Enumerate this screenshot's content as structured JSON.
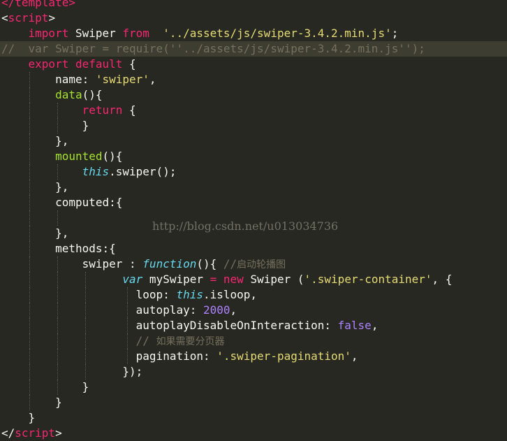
{
  "editor": {
    "lines": [
      {
        "highlight": false,
        "guides": [],
        "tokens": [
          [
            "t-tag",
            "</template>"
          ]
        ]
      },
      {
        "highlight": false,
        "guides": [],
        "tokens": [
          [
            "t-punc",
            "<"
          ],
          [
            "t-tag",
            "script"
          ],
          [
            "t-punc",
            ">"
          ]
        ]
      },
      {
        "highlight": false,
        "guides": [],
        "tokens": [
          [
            "t-plain",
            "    "
          ],
          [
            "t-kw",
            "import"
          ],
          [
            "t-plain",
            " Swiper "
          ],
          [
            "t-kw",
            "from"
          ],
          [
            "t-plain",
            "  "
          ],
          [
            "t-str",
            "'../assets/js/swiper-3.4.2.min.js'"
          ],
          [
            "t-plain",
            ";"
          ]
        ]
      },
      {
        "highlight": true,
        "guides": [],
        "tokens": [
          [
            "t-comment",
            "//  var Swiper = require(''../assets/js/swiper-3.4.2.min.js'');"
          ]
        ]
      },
      {
        "highlight": false,
        "guides": [],
        "tokens": [
          [
            "t-plain",
            "    "
          ],
          [
            "t-kw",
            "export"
          ],
          [
            "t-plain",
            " "
          ],
          [
            "t-kw",
            "default"
          ],
          [
            "t-plain",
            " {"
          ]
        ]
      },
      {
        "highlight": false,
        "guides": [
          42
        ],
        "tokens": [
          [
            "t-plain",
            "        name: "
          ],
          [
            "t-str",
            "'swiper'"
          ],
          [
            "t-plain",
            ","
          ]
        ]
      },
      {
        "highlight": false,
        "guides": [
          42
        ],
        "tokens": [
          [
            "t-plain",
            "        "
          ],
          [
            "t-fn",
            "data"
          ],
          [
            "t-plain",
            "(){"
          ]
        ]
      },
      {
        "highlight": false,
        "guides": [
          42,
          82
        ],
        "tokens": [
          [
            "t-plain",
            "            "
          ],
          [
            "t-kw",
            "return"
          ],
          [
            "t-plain",
            " {"
          ]
        ]
      },
      {
        "highlight": false,
        "guides": [
          42,
          82
        ],
        "tokens": [
          [
            "t-plain",
            "            }"
          ]
        ]
      },
      {
        "highlight": false,
        "guides": [
          42
        ],
        "tokens": [
          [
            "t-plain",
            "        },"
          ]
        ]
      },
      {
        "highlight": false,
        "guides": [
          42
        ],
        "tokens": [
          [
            "t-plain",
            "        "
          ],
          [
            "t-fn",
            "mounted"
          ],
          [
            "t-plain",
            "(){"
          ]
        ]
      },
      {
        "highlight": false,
        "guides": [
          42,
          82
        ],
        "tokens": [
          [
            "t-plain",
            "            "
          ],
          [
            "t-this",
            "this"
          ],
          [
            "t-plain",
            ".swiper();"
          ]
        ]
      },
      {
        "highlight": false,
        "guides": [
          42
        ],
        "tokens": [
          [
            "t-plain",
            "        },"
          ]
        ]
      },
      {
        "highlight": false,
        "guides": [
          42
        ],
        "tokens": [
          [
            "t-plain",
            "        computed:{"
          ]
        ]
      },
      {
        "highlight": false,
        "guides": [
          42,
          82
        ],
        "tokens": [
          [
            "t-plain",
            ""
          ]
        ]
      },
      {
        "highlight": false,
        "guides": [
          42
        ],
        "tokens": [
          [
            "t-plain",
            "        },"
          ]
        ]
      },
      {
        "highlight": false,
        "guides": [
          42
        ],
        "tokens": [
          [
            "t-plain",
            "        methods:{"
          ]
        ]
      },
      {
        "highlight": false,
        "guides": [
          42,
          82
        ],
        "tokens": [
          [
            "t-plain",
            "            swiper : "
          ],
          [
            "t-storage",
            "function"
          ],
          [
            "t-plain",
            "(){ "
          ],
          [
            "t-comment",
            "//"
          ],
          [
            "t-comment-cjk",
            "启动轮播图"
          ]
        ]
      },
      {
        "highlight": false,
        "guides": [
          42,
          82,
          122
        ],
        "tokens": [
          [
            "t-plain",
            "                  "
          ],
          [
            "t-storage",
            "var"
          ],
          [
            "t-plain",
            " mySwiper "
          ],
          [
            "t-kw",
            "="
          ],
          [
            "t-plain",
            " "
          ],
          [
            "t-kw",
            "new"
          ],
          [
            "t-plain",
            " Swiper ("
          ],
          [
            "t-str",
            "'.swiper-container'"
          ],
          [
            "t-plain",
            ", {"
          ]
        ]
      },
      {
        "highlight": false,
        "guides": [
          42,
          82,
          122,
          182
        ],
        "tokens": [
          [
            "t-plain",
            "                    loop: "
          ],
          [
            "t-this",
            "this"
          ],
          [
            "t-plain",
            ".isloop,"
          ]
        ]
      },
      {
        "highlight": false,
        "guides": [
          42,
          82,
          122,
          182
        ],
        "tokens": [
          [
            "t-plain",
            "                    autoplay: "
          ],
          [
            "t-num",
            "2000"
          ],
          [
            "t-plain",
            ","
          ]
        ]
      },
      {
        "highlight": false,
        "guides": [
          42,
          82,
          122,
          182
        ],
        "tokens": [
          [
            "t-plain",
            "                    autoplayDisableOnInteraction: "
          ],
          [
            "t-const",
            "false"
          ],
          [
            "t-plain",
            ","
          ]
        ]
      },
      {
        "highlight": false,
        "guides": [
          42,
          82,
          122,
          182
        ],
        "tokens": [
          [
            "t-plain",
            "                    "
          ],
          [
            "t-comment",
            "// "
          ],
          [
            "t-comment-cjk",
            "如果需要分页器"
          ]
        ]
      },
      {
        "highlight": false,
        "guides": [
          42,
          82,
          122,
          182
        ],
        "tokens": [
          [
            "t-plain",
            "                    pagination: "
          ],
          [
            "t-str",
            "'.swiper-pagination'"
          ],
          [
            "t-plain",
            ","
          ]
        ]
      },
      {
        "highlight": false,
        "guides": [
          42,
          82,
          122
        ],
        "tokens": [
          [
            "t-plain",
            "                  });"
          ]
        ]
      },
      {
        "highlight": false,
        "guides": [
          42,
          82
        ],
        "tokens": [
          [
            "t-plain",
            "            }"
          ]
        ]
      },
      {
        "highlight": false,
        "guides": [
          42
        ],
        "tokens": [
          [
            "t-plain",
            "        }"
          ]
        ]
      },
      {
        "highlight": false,
        "guides": [],
        "tokens": [
          [
            "t-plain",
            "    }"
          ]
        ]
      },
      {
        "highlight": false,
        "guides": [],
        "tokens": [
          [
            "t-punc",
            "</"
          ],
          [
            "t-tag",
            "script"
          ],
          [
            "t-punc",
            ">"
          ]
        ]
      }
    ]
  },
  "watermark": {
    "text": "http://blog.csdn.net/u013034736"
  }
}
